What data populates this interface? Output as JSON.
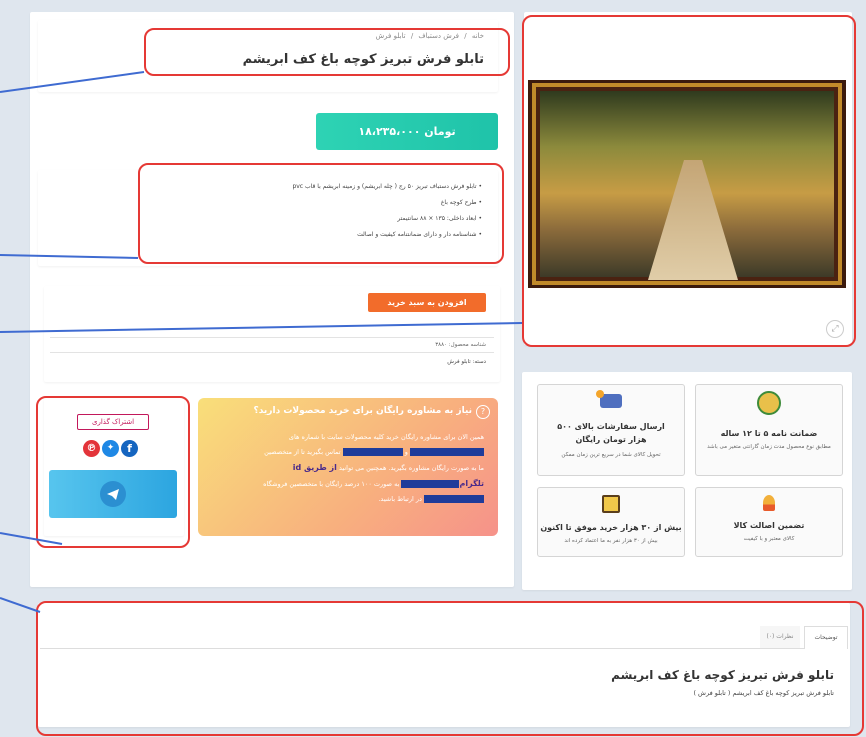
{
  "breadcrumb": {
    "home": "خانه",
    "sep": "/",
    "cat1": "فرش دستباف",
    "cat2": "تابلو فرش"
  },
  "product": {
    "title": "تابلو فرش تبریز کوچه باغ کف ابریشم",
    "price": "۱۸،۲۳۵،۰۰۰ تومان",
    "features": [
      "تابلو فرش دستباف تبریز ۵۰ رج ( چله ابریشم) و زمینه ابریشم با قاب pvc",
      "طرح کوچه باغ",
      "ابعاد داخلی: ۱۳۵ × ۸۸ سانتیمتر",
      "شناسنامه دار و دارای ضمانتنامه کیفیت و اصالت"
    ],
    "add_to_cart": "افزودن به سبد خرید",
    "sku_label": "شناسه محصول: ۳۸۸۰",
    "category_label": "دسته: تابلو فرش"
  },
  "consult": {
    "title": "نیاز به مشاوره رایگان برای خرید محصولات دارید؟",
    "line1": "همین الان برای مشاوره رایگان خرید کلیه محصولات سایت با شماره های",
    "line2a": "و",
    "line2b": "تماس بگیرید تا از متخصصین",
    "line3": "ما به صورت رایگان مشاوره بگیرید. همچنین می توانید",
    "highlight": "از طریق id",
    "highlight2": "تلگرام",
    "line4": "به صورت ۱۰۰ درصد رایگان با متخصصین فروشگاه",
    "line5": "در ارتباط باشید."
  },
  "share": {
    "label": "اشتراک گذاری"
  },
  "features_boxes": [
    {
      "title": "ضمانت نامه ۵ تا ۱۲ ساله",
      "sub": "مطابق نوع محصول مدت زمان گارانتی متغیر می باشد"
    },
    {
      "title": "ارسال سفارشات بالای ۵۰۰ هزار تومان رایگان",
      "sub": "تحویل کالای شما در سریع ترین زمان ممکن"
    },
    {
      "title": "تضمین اصالت کالا",
      "sub": "کالای معتبر و با کیفیت"
    },
    {
      "title": "بیش از ۳۰ هزار خرید موفق تا اکنون",
      "sub": "بیش از ۳۰ هزار نفر به ما اعتماد کرده اند"
    }
  ],
  "tabs": {
    "description": "توضیحات",
    "reviews": "نظرات (۰)"
  },
  "description": {
    "title": "تابلو فرش تبریز کوچه باغ کف ابریشم",
    "text": "تابلو فرش تبریز کوچه باغ کف ابریشم ( تابلو فرش )"
  },
  "colors": {
    "price_gradient_start": "#2ecfa6",
    "price_gradient_end": "#20c2a8",
    "cart_button": "#f26c2b",
    "highlight_border": "#e53935",
    "annotation_line": "#3f6bd1"
  }
}
